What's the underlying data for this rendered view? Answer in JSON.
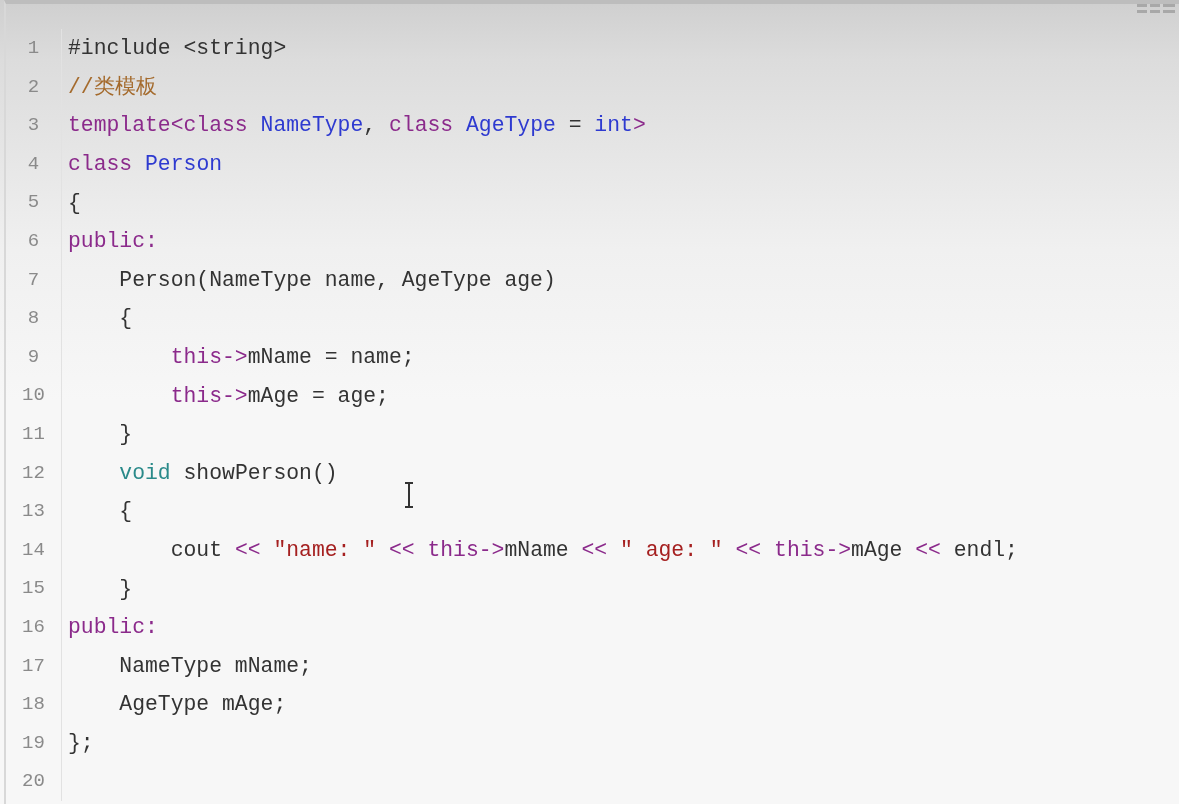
{
  "editor": {
    "lines": [
      {
        "number": "1",
        "tokens": [
          {
            "text": "#include <string>",
            "kind": "plain"
          }
        ]
      },
      {
        "number": "2",
        "tokens": [
          {
            "text": "//类模板",
            "kind": "comment"
          }
        ]
      },
      {
        "number": "3",
        "tokens": [
          {
            "text": "template<class ",
            "kind": "keyword"
          },
          {
            "text": "NameType",
            "kind": "type"
          },
          {
            "text": ", ",
            "kind": "plain"
          },
          {
            "text": "class ",
            "kind": "keyword"
          },
          {
            "text": "AgeType",
            "kind": "type"
          },
          {
            "text": " = ",
            "kind": "plain"
          },
          {
            "text": "int",
            "kind": "type"
          },
          {
            "text": ">",
            "kind": "keyword"
          }
        ]
      },
      {
        "number": "4",
        "tokens": [
          {
            "text": "class ",
            "kind": "keyword"
          },
          {
            "text": "Person",
            "kind": "type"
          }
        ]
      },
      {
        "number": "5",
        "tokens": [
          {
            "text": "{",
            "kind": "plain"
          }
        ]
      },
      {
        "number": "6",
        "tokens": [
          {
            "text": "public:",
            "kind": "keyword"
          }
        ]
      },
      {
        "number": "7",
        "tokens": [
          {
            "text": "    Person(NameType name, AgeType age)",
            "kind": "plain"
          }
        ]
      },
      {
        "number": "8",
        "tokens": [
          {
            "text": "    {",
            "kind": "plain"
          }
        ]
      },
      {
        "number": "9",
        "tokens": [
          {
            "text": "        this->",
            "kind": "keyword"
          },
          {
            "text": "mName = name;",
            "kind": "plain"
          }
        ]
      },
      {
        "number": "10",
        "tokens": [
          {
            "text": "        this->",
            "kind": "keyword"
          },
          {
            "text": "mAge = age;",
            "kind": "plain"
          }
        ]
      },
      {
        "number": "11",
        "tokens": [
          {
            "text": "    }",
            "kind": "plain"
          }
        ]
      },
      {
        "number": "12",
        "tokens": [
          {
            "text": "    void ",
            "kind": "builtin"
          },
          {
            "text": "showPerson()",
            "kind": "plain"
          }
        ]
      },
      {
        "number": "13",
        "tokens": [
          {
            "text": "    {",
            "kind": "plain"
          }
        ]
      },
      {
        "number": "14",
        "tokens": [
          {
            "text": "        cout ",
            "kind": "plain"
          },
          {
            "text": "<< ",
            "kind": "keyword"
          },
          {
            "text": "\"name: \" ",
            "kind": "string"
          },
          {
            "text": "<< this->",
            "kind": "keyword"
          },
          {
            "text": "mName ",
            "kind": "plain"
          },
          {
            "text": "<< ",
            "kind": "keyword"
          },
          {
            "text": "\" age: \" ",
            "kind": "string"
          },
          {
            "text": "<< this->",
            "kind": "keyword"
          },
          {
            "text": "mAge ",
            "kind": "plain"
          },
          {
            "text": "<< ",
            "kind": "keyword"
          },
          {
            "text": "endl;",
            "kind": "plain"
          }
        ]
      },
      {
        "number": "15",
        "tokens": [
          {
            "text": "    }",
            "kind": "plain"
          }
        ]
      },
      {
        "number": "16",
        "tokens": [
          {
            "text": "public:",
            "kind": "keyword"
          }
        ]
      },
      {
        "number": "17",
        "tokens": [
          {
            "text": "    NameType mName;",
            "kind": "plain"
          }
        ]
      },
      {
        "number": "18",
        "tokens": [
          {
            "text": "    AgeType mAge;",
            "kind": "plain"
          }
        ]
      },
      {
        "number": "19",
        "tokens": [
          {
            "text": "};",
            "kind": "plain"
          }
        ]
      },
      {
        "number": "20"
      }
    ]
  }
}
